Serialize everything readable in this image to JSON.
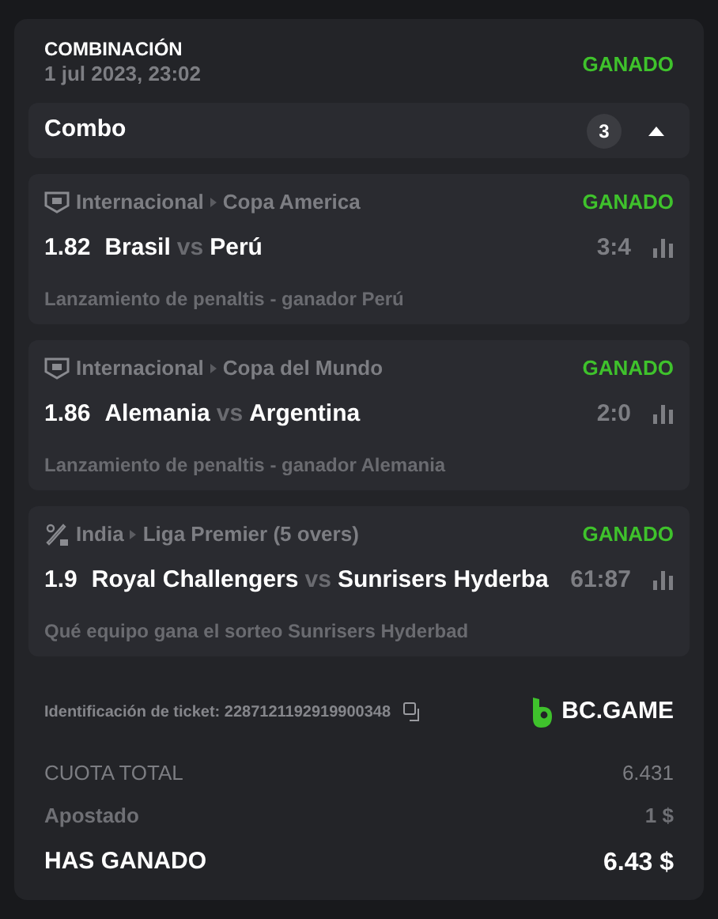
{
  "header": {
    "title": "COMBINACIÓN",
    "date": "1 jul 2023, 23:02",
    "status": "GANADO"
  },
  "combo": {
    "label": "Combo",
    "count": "3",
    "expanded": true
  },
  "matches": [
    {
      "kind": "fifa",
      "country": "Internacional",
      "league": "Copa America",
      "status": "GANADO",
      "odds": "1.82",
      "home": "Brasil",
      "vs": "vs",
      "away": "Perú",
      "score": "3:4",
      "market": "Lanzamiento de penaltis - ganador Perú"
    },
    {
      "kind": "fifa",
      "country": "Internacional",
      "league": "Copa del Mundo",
      "status": "GANADO",
      "odds": "1.86",
      "home": "Alemania",
      "vs": "vs",
      "away": "Argentina",
      "score": "2:0",
      "market": "Lanzamiento de penaltis - ganador Alemania"
    },
    {
      "kind": "cricket",
      "country": "India",
      "league": "Liga Premier (5 overs)",
      "status": "GANADO",
      "odds": "1.9",
      "home": "Royal Challengers",
      "vs": "vs",
      "away": "Sunrisers Hyderba",
      "score": "61:87",
      "market": "Qué equipo gana el sorteo Sunrisers Hyderbad"
    }
  ],
  "ticket": {
    "label": "Identificación de ticket: 2287121192919900348",
    "brand": "BC.GAME"
  },
  "totals": [
    {
      "kind": "plain",
      "label": "CUOTA TOTAL",
      "value": "6.431"
    },
    {
      "kind": "muted",
      "label": "Apostado",
      "value": "1 $"
    },
    {
      "kind": "strong",
      "label": "HAS GANADO",
      "value": "6.43 $"
    }
  ]
}
